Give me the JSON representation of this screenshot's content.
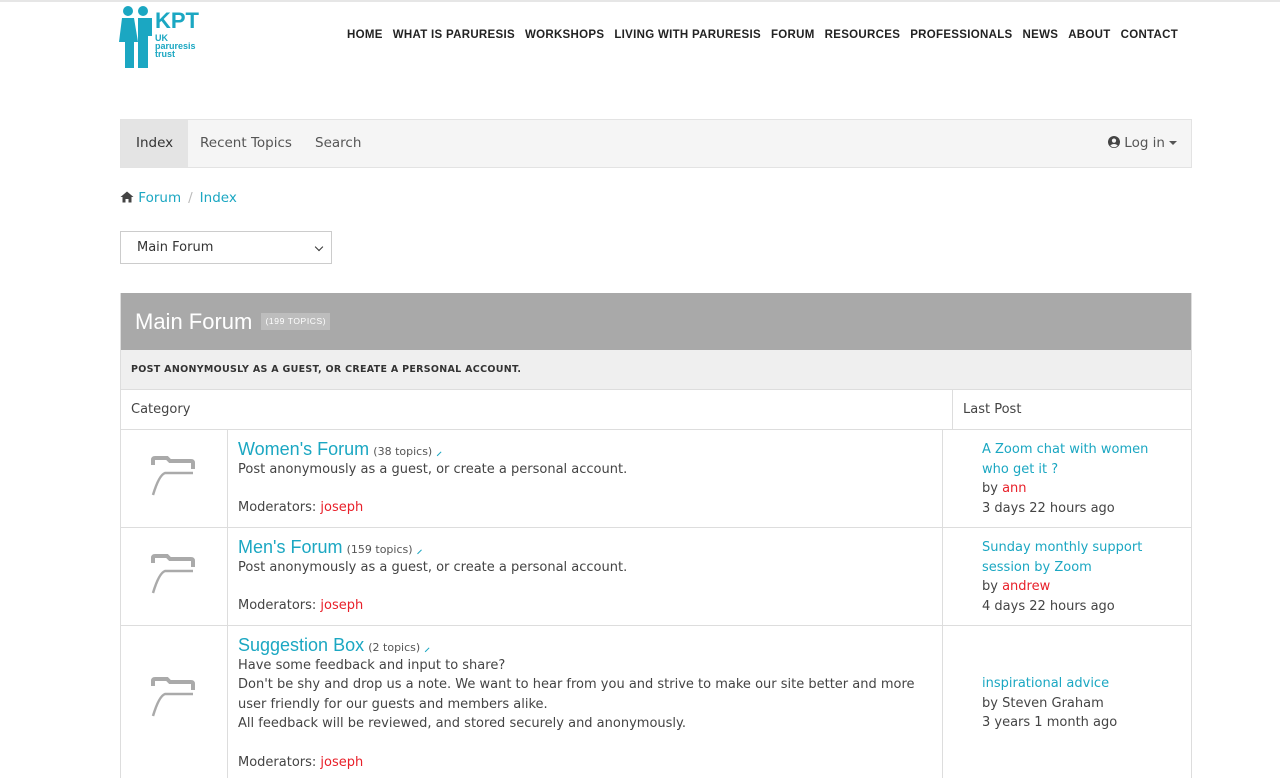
{
  "logo": {
    "kpt": "KPT",
    "line1": "UK",
    "line2": "paruresis",
    "line3": "trust"
  },
  "nav": [
    "HOME",
    "WHAT IS PARURESIS",
    "WORKSHOPS",
    "LIVING WITH PARURESIS",
    "FORUM",
    "RESOURCES",
    "PROFESSIONALS",
    "NEWS",
    "ABOUT",
    "CONTACT"
  ],
  "forum_nav": {
    "tabs": [
      "Index",
      "Recent Topics",
      "Search"
    ],
    "active": "Index",
    "login": "Log in"
  },
  "breadcrumb": {
    "home": "Forum",
    "sep": "/",
    "current": "Index"
  },
  "select": {
    "value": "Main Forum"
  },
  "panel": {
    "title": "Main Forum",
    "badge": "(199 TOPICS)",
    "subhead": "POST ANONYMOUSLY AS A GUEST, OR CREATE A PERSONAL ACCOUNT.",
    "col_category": "Category",
    "col_last": "Last Post"
  },
  "forums": [
    {
      "title": "Women's Forum",
      "count": "(38 topics)",
      "desc": [
        "Post anonymously as a guest, or create a personal account."
      ],
      "mod_label": "Moderators:",
      "mod": "joseph",
      "last_title": "A Zoom chat with women who get it ?",
      "by": "by",
      "last_author": "ann",
      "last_time": "3 days 22 hours ago"
    },
    {
      "title": "Men's Forum",
      "count": "(159 topics)",
      "desc": [
        "Post anonymously as a guest, or create a personal account."
      ],
      "mod_label": "Moderators:",
      "mod": "joseph",
      "last_title": "Sunday monthly support session by Zoom",
      "by": "by",
      "last_author": "andrew",
      "last_time": "4 days 22 hours ago"
    },
    {
      "title": "Suggestion Box",
      "count": "(2 topics)",
      "desc": [
        "Have some feedback and input to share?",
        "Don't be shy and drop us a note. We want to hear from you and strive to make our site better and more user friendly for our guests and members alike.",
        "All feedback will be reviewed, and stored securely and anonymously."
      ],
      "mod_label": "Moderators:",
      "mod": "joseph",
      "last_title": "inspirational advice",
      "by": "by",
      "last_author": "Steven Graham",
      "last_time": "3 years 1 month ago"
    }
  ],
  "colors": {
    "accent": "#1ba7c2",
    "user": "#e8202a",
    "panel_head": "#a9a9a9"
  },
  "icons": {
    "home": "home-icon",
    "user": "user-circle-icon",
    "rss": "rss-icon",
    "folder": "folder-icon"
  }
}
